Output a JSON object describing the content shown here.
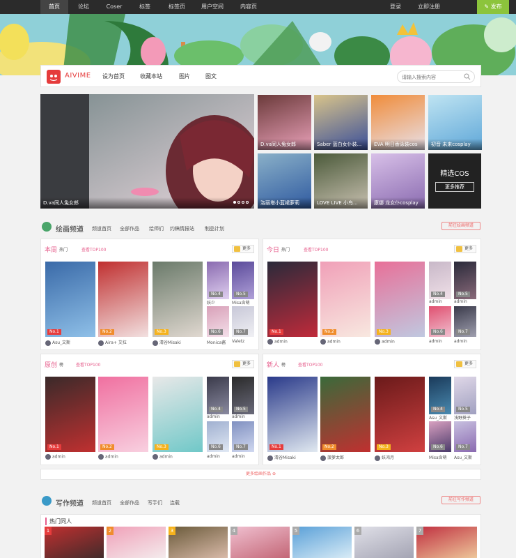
{
  "topnav": {
    "items": [
      "首页",
      "论坛",
      "Coser",
      "标签",
      "标签页",
      "用户空间",
      "内容页"
    ],
    "login": "登录",
    "register": "立即注册",
    "publish": "发布"
  },
  "header": {
    "logo_text": "AIVIME",
    "nav": [
      "设为首页",
      "收藏本站",
      "图片",
      "图文"
    ],
    "search_placeholder": "请输入搜索内容"
  },
  "slider": {
    "main_caption": "D.va同人兔女郎",
    "thumbs": [
      {
        "caption": "D.va同人兔女郎"
      },
      {
        "caption": "Saber 蓝白女仆装..."
      },
      {
        "caption": "EVA 明日香泳装cos"
      },
      {
        "caption": "初音 未来cosplay"
      },
      {
        "caption": "洛丽塔小蓝裙萝莉"
      },
      {
        "caption": "LOVE LIVE 小鸟..."
      },
      {
        "caption": "康娜 龙女仆cosplay"
      }
    ],
    "cos_title": "精选COS",
    "cos_button": "更多推荐"
  },
  "draw_channel": {
    "title": "绘画频道",
    "links": [
      "频道首页",
      "全部作品",
      "绘师们",
      "约稿情报站",
      "制品计划"
    ],
    "more": "前往绘画频道",
    "panels": [
      {
        "title": "本周",
        "subtitle": "热门",
        "rank": "查看TOP100",
        "more": "更多",
        "cards": [
          {
            "badge": "No.1",
            "author": "Asu_文斯"
          },
          {
            "badge": "No.2",
            "author": "Aira+ 艾拉"
          },
          {
            "badge": "No.3",
            "author": "清谷Misaki"
          },
          {
            "badge": "No.4",
            "author": "妖少"
          },
          {
            "badge": "No.5",
            "author": "Misa含萌"
          },
          {
            "badge": "No.6",
            "author": "Monica酱"
          },
          {
            "badge": "No.7",
            "author": "Valetz"
          }
        ]
      },
      {
        "title": "今日",
        "subtitle": "热门",
        "rank": "查看TOP100",
        "more": "更多",
        "cards": [
          {
            "badge": "No.1",
            "author": "admin"
          },
          {
            "badge": "No.2",
            "author": "admin"
          },
          {
            "badge": "No.3",
            "author": "admin"
          },
          {
            "badge": "No.4",
            "author": "admin"
          },
          {
            "badge": "No.5",
            "author": "admin"
          },
          {
            "badge": "No.6",
            "author": "admin"
          },
          {
            "badge": "No.7",
            "author": "admin"
          }
        ]
      },
      {
        "title": "原创",
        "subtitle": "榜",
        "rank": "查看TOP100",
        "more": "更多",
        "cards": [
          {
            "badge": "No.1",
            "author": "admin"
          },
          {
            "badge": "No.2",
            "author": "admin"
          },
          {
            "badge": "No.3",
            "author": "admin"
          },
          {
            "badge": "No.4",
            "author": "admin"
          },
          {
            "badge": "No.5",
            "author": "admin"
          },
          {
            "badge": "No.6",
            "author": "admin"
          },
          {
            "badge": "No.7",
            "author": "admin"
          }
        ]
      },
      {
        "title": "新人",
        "subtitle": "榜",
        "rank": "查看TOP100",
        "more": "更多",
        "cards": [
          {
            "badge": "No.1",
            "author": "清谷Misaki"
          },
          {
            "badge": "No.2",
            "author": "菠萝太郎"
          },
          {
            "badge": "No.3",
            "author": "妖鸿月"
          },
          {
            "badge": "No.4",
            "author": "Asu_文斯"
          },
          {
            "badge": "No.5",
            "author": "浅野葵子"
          },
          {
            "badge": "No.6",
            "author": "Misa含萌"
          },
          {
            "badge": "No.7",
            "author": "Asu_文斯"
          }
        ]
      }
    ],
    "more_works": "更多绘画作品"
  },
  "write_channel": {
    "title": "写作频道",
    "links": [
      "频道首页",
      "全部作品",
      "写手们",
      "连载"
    ],
    "more": "前往写作频道",
    "section": "热门同人",
    "nums": [
      "1",
      "2",
      "3",
      "4",
      "5",
      "6",
      "7"
    ]
  },
  "colors": {
    "accent": "#e65c8b",
    "green": "#8cc43c",
    "nav_bg": "#2b2b2b"
  }
}
